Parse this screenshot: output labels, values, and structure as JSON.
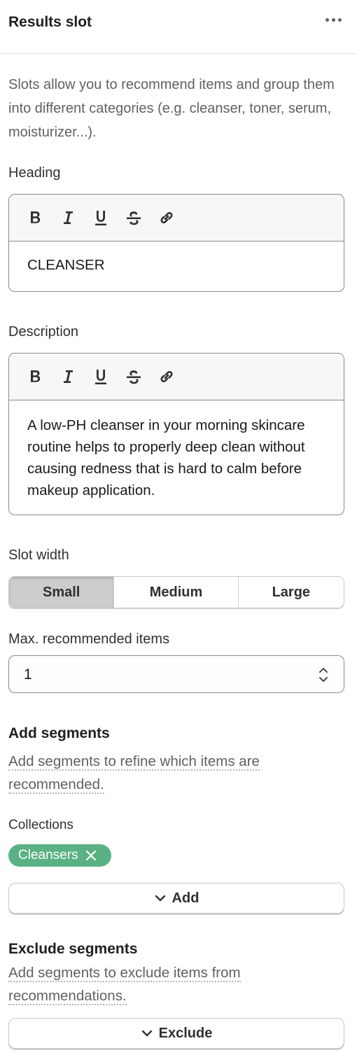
{
  "header": {
    "title": "Results slot"
  },
  "intro": "Slots allow you to recommend items and group them into different categories (e.g. cleanser, toner, serum, moisturizer...).",
  "heading": {
    "label": "Heading",
    "value": "CLEANSER"
  },
  "description": {
    "label": "Description",
    "value": "A low-PH cleanser in your morning skincare routine helps to properly deep clean without causing redness that is hard to calm before makeup application."
  },
  "toolbar": {
    "bold": "B",
    "italic": "I",
    "underline": "U"
  },
  "slot_width": {
    "label": "Slot width",
    "options": [
      "Small",
      "Medium",
      "Large"
    ],
    "selected": "Small"
  },
  "max_items": {
    "label": "Max. recommended items",
    "value": "1"
  },
  "add_segments": {
    "title": "Add segments",
    "help": "Add segments to refine which items are recommended.",
    "collections_label": "Collections",
    "tag": "Cleansers",
    "button": "Add"
  },
  "exclude_segments": {
    "title": "Exclude segments",
    "help": "Add segments to exclude items from recommendations.",
    "button": "Exclude"
  },
  "colors": {
    "tag_bg": "#5ab183",
    "segment_active": "#cccccc"
  }
}
